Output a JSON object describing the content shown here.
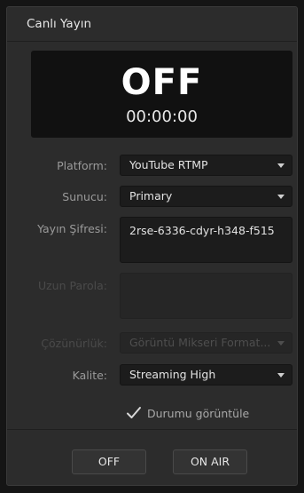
{
  "panel": {
    "title": "Canlı Yayın"
  },
  "status": {
    "state": "OFF",
    "time": "00:00:00"
  },
  "form": {
    "platform": {
      "label": "Platform:",
      "value": "YouTube RTMP"
    },
    "server": {
      "label": "Sunucu:",
      "value": "Primary"
    },
    "stream_key": {
      "label": "Yayın Şifresi:",
      "value": "2rse-6336-cdyr-h348-f515"
    },
    "long_password": {
      "label": "Uzun Parola:",
      "value": ""
    },
    "resolution": {
      "label": "Çözünürlük:",
      "value": "Görüntü Mikseri Format..."
    },
    "quality": {
      "label": "Kalite:",
      "value": "Streaming High"
    },
    "show_status": {
      "label": "Durumu görüntüle",
      "checked": true
    }
  },
  "buttons": {
    "off": "OFF",
    "on_air": "ON AIR"
  },
  "colors": {
    "panel_bg": "#2c2c2c",
    "display_bg": "#111111",
    "field_bg": "#1c1c1c",
    "label_text": "#9a9a9a",
    "disabled_text": "#4a4a4a"
  },
  "icons": {
    "dropdown": "chevron-down-icon",
    "checkbox": "checkmark-icon"
  }
}
